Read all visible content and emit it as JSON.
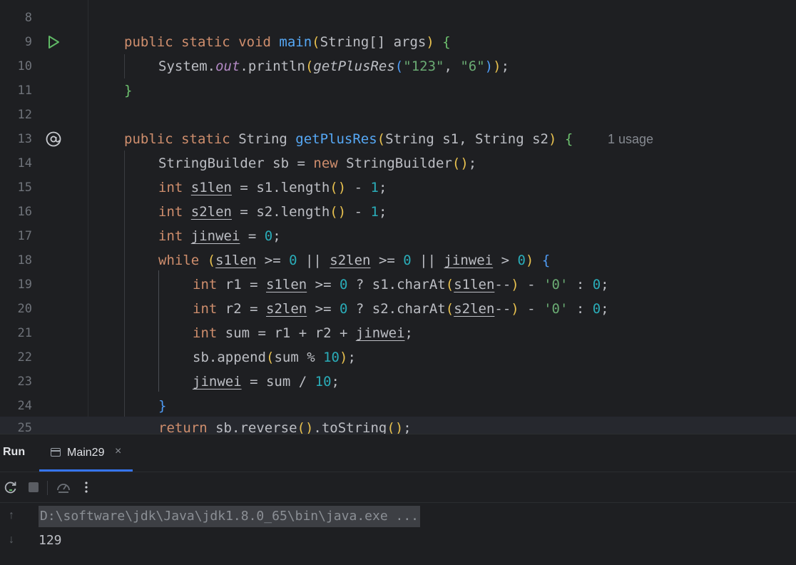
{
  "editor": {
    "lines": [
      {
        "num": "8"
      },
      {
        "num": "9",
        "kw1": "public",
        "kw2": "static",
        "kw3": "void",
        "name": "main",
        "type": "String",
        "arr": "[]",
        "param": "args"
      },
      {
        "num": "10",
        "cls": "System",
        "field": "out",
        "method": "println",
        "call": "getPlusRes",
        "arg1": "\"123\"",
        "arg2": "\"6\""
      },
      {
        "num": "11"
      },
      {
        "num": "12"
      },
      {
        "num": "13",
        "kw1": "public",
        "kw2": "static",
        "type": "String",
        "name": "getPlusRes",
        "p1type": "String",
        "p1": "s1",
        "p2type": "String",
        "p2": "s2",
        "hint": "1 usage"
      },
      {
        "num": "14",
        "type": "StringBuilder",
        "var": "sb",
        "kw": "new",
        "ctor": "StringBuilder"
      },
      {
        "num": "15",
        "type": "int",
        "var": "s1len",
        "obj": "s1",
        "method": "length",
        "val": "1"
      },
      {
        "num": "16",
        "type": "int",
        "var": "s2len",
        "obj": "s2",
        "method": "length",
        "val": "1"
      },
      {
        "num": "17",
        "type": "int",
        "var": "jinwei",
        "val": "0"
      },
      {
        "num": "18",
        "kw": "while",
        "v1": "s1len",
        "v2": "s2len",
        "v3": "jinwei",
        "zero": "0"
      },
      {
        "num": "19",
        "type": "int",
        "var": "r1",
        "v": "s1len",
        "obj": "s1",
        "method": "charAt",
        "ch": "'0'",
        "zero": "0"
      },
      {
        "num": "20",
        "type": "int",
        "var": "r2",
        "v": "s2len",
        "obj": "s2",
        "method": "charAt",
        "ch": "'0'",
        "zero": "0"
      },
      {
        "num": "21",
        "type": "int",
        "var": "sum",
        "a": "r1",
        "b": "r2",
        "c": "jinwei"
      },
      {
        "num": "22",
        "obj": "sb",
        "method": "append",
        "arg": "sum",
        "val": "10"
      },
      {
        "num": "23",
        "var": "jinwei",
        "arg": "sum",
        "val": "10"
      },
      {
        "num": "24"
      },
      {
        "num": "25",
        "kw": "return",
        "obj": "sb",
        "m1": "reverse",
        "m2": "toString"
      }
    ]
  },
  "run": {
    "title": "Run",
    "tab_label": "Main29",
    "tab_close": "×",
    "command": "D:\\software\\jdk\\Java\\jdk1.8.0_65\\bin\\java.exe ...",
    "output": "129"
  },
  "icons": {
    "run_gutter": "run-triangle-icon",
    "implements_gutter": "at-sign-icon",
    "rerun": "rerun-icon",
    "stop": "stop-icon",
    "profiler": "gauge-icon",
    "more": "more-vertical-icon",
    "up": "arrow-up-icon",
    "down": "arrow-down-icon"
  },
  "colors": {
    "accent": "#3574f0",
    "keyword": "#cf8e6d",
    "function": "#56a8f5",
    "string": "#6aab73",
    "number": "#2aacb8",
    "static_field": "#b389c5"
  }
}
